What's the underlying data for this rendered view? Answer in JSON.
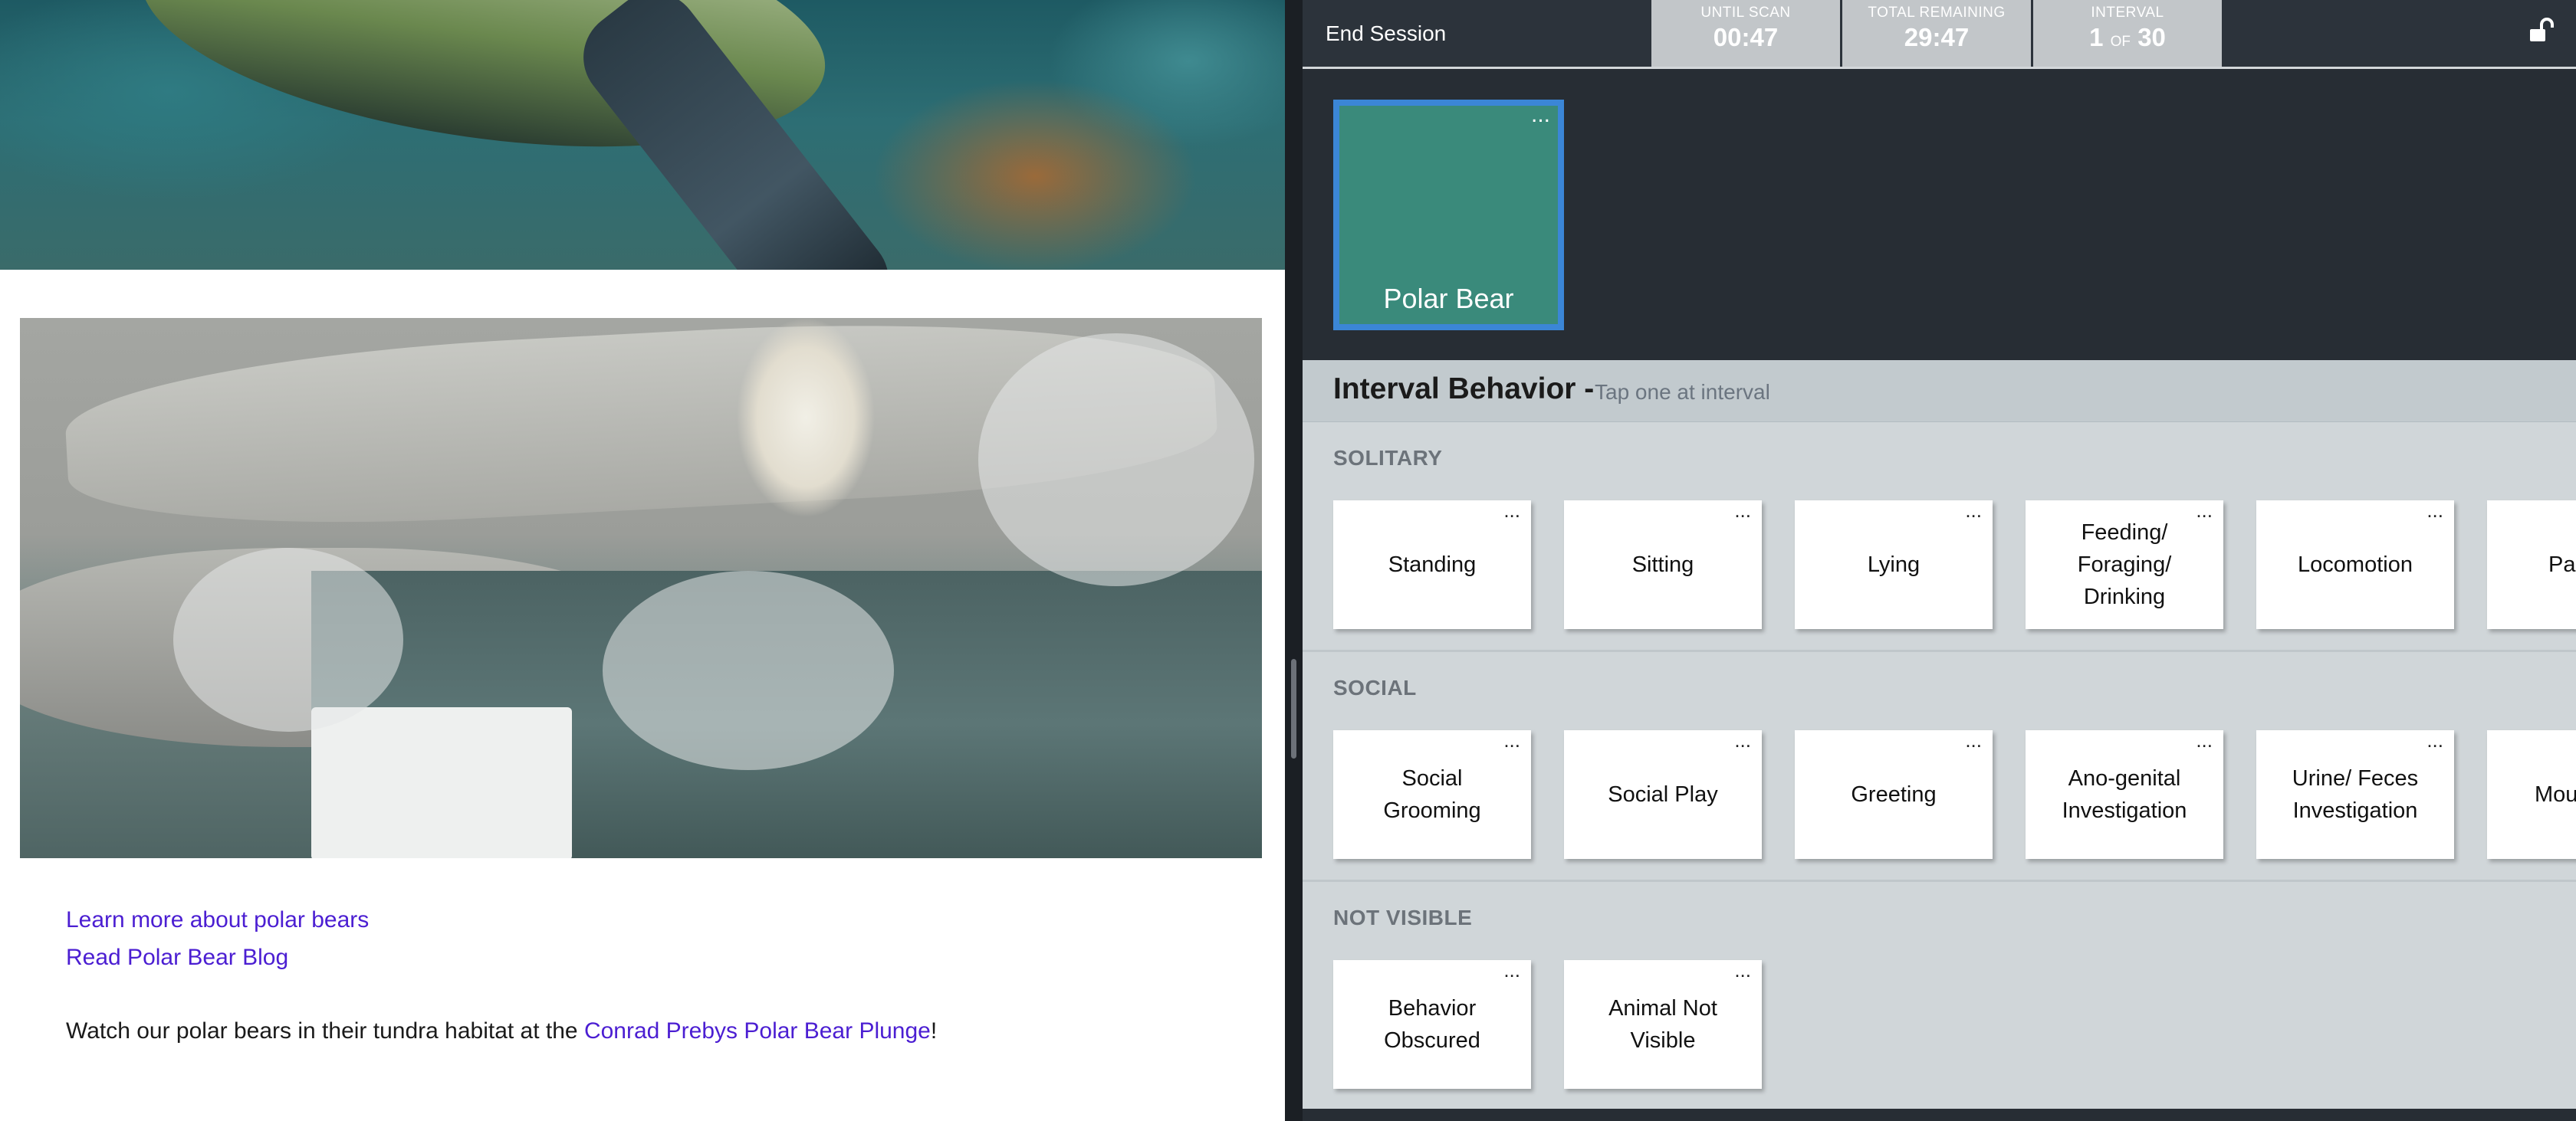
{
  "left_page": {
    "learn_link": "Learn more about polar bears",
    "blog_link": "Read Polar Bear Blog",
    "watch_prefix": "Watch our polar bears in their tundra habitat at the ",
    "watch_link": "Conrad Prebys Polar Bear Plunge",
    "watch_suffix": "!"
  },
  "app": {
    "end_session": "End Session",
    "stats": [
      {
        "label": "UNTIL SCAN",
        "value": "00:47"
      },
      {
        "label": "TOTAL REMAINING",
        "value": "29:47"
      },
      {
        "label": "INTERVAL",
        "value_current": "1",
        "value_of": "OF",
        "value_total": "30"
      }
    ],
    "lock_icon": "unlock-icon",
    "subject": {
      "name": "Polar Bear",
      "menu": "...",
      "color": "#3a8a7b",
      "selected_border": "#3b86d6"
    },
    "behavior_title": "Interval Behavior -",
    "behavior_hint": "Tap one at interval",
    "sections": [
      {
        "label": "SOLITARY",
        "buttons": [
          "Standing",
          "Sitting",
          "Lying",
          "Feeding/ Foraging/ Drinking",
          "Locomotion",
          "Pa"
        ]
      },
      {
        "label": "SOCIAL",
        "buttons": [
          "Social Grooming",
          "Social Play",
          "Greeting",
          "Ano-genital Investigation",
          "Urine/ Feces Investigation",
          "Mou"
        ]
      },
      {
        "label": "NOT VISIBLE",
        "buttons": [
          "Behavior Obscured",
          "Animal Not Visible"
        ]
      }
    ],
    "button_menu": "..."
  },
  "colors": {
    "link": "#4b1ed2",
    "app_bg": "#272d34",
    "panel_bg": "#d0d6d9",
    "stat_bg": "#c2c6c9"
  }
}
